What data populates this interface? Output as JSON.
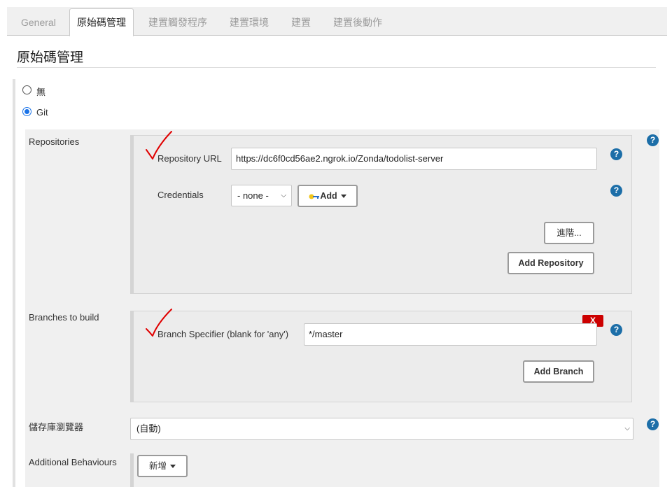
{
  "tabs": [
    {
      "label": "General"
    },
    {
      "label": "原始碼管理"
    },
    {
      "label": "建置觸發程序"
    },
    {
      "label": "建置環境"
    },
    {
      "label": "建置"
    },
    {
      "label": "建置後動作"
    }
  ],
  "section_title": "原始碼管理",
  "scm": {
    "options": [
      {
        "label": "無",
        "checked": false
      },
      {
        "label": "Git",
        "checked": true
      }
    ]
  },
  "repositories": {
    "label": "Repositories",
    "url_label": "Repository URL",
    "url_value": "https://dc6f0cd56ae2.ngrok.io/Zonda/todolist-server",
    "credentials_label": "Credentials",
    "credentials_value": "- none -",
    "add_label": "Add",
    "advanced_label": "進階...",
    "add_repository_label": "Add Repository"
  },
  "branches": {
    "label": "Branches to build",
    "delete_label": "X",
    "specifier_label": "Branch Specifier (blank for 'any')",
    "specifier_value": "*/master",
    "add_branch_label": "Add Branch"
  },
  "browser": {
    "label": "儲存庫瀏覽器",
    "value": "(自動)"
  },
  "behaviours": {
    "label": "Additional Behaviours",
    "add_label": "新增"
  },
  "help_symbol": "?",
  "colors": {
    "accent": "#1a73e8",
    "help": "#1c6ea8",
    "delete": "#cc0000",
    "annotation": "#e00000"
  },
  "icons": {
    "help": "question-circle-icon",
    "credentials_add": "key-icon",
    "annotation": "red-checkmark-icon"
  }
}
